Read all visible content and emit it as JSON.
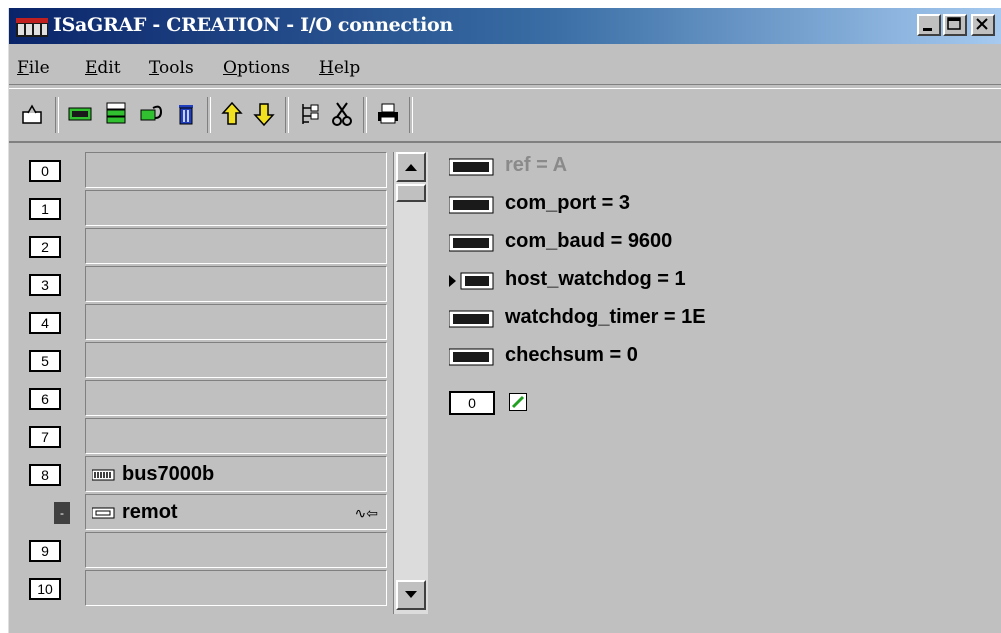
{
  "window": {
    "title": "ISaGRAF - CREATION - I/O connection",
    "controls": [
      "minimize",
      "maximize",
      "close"
    ]
  },
  "menu": [
    {
      "key": "F",
      "rest": "ile"
    },
    {
      "key": "E",
      "rest": "dit"
    },
    {
      "key": "T",
      "rest": "ools"
    },
    {
      "key": "O",
      "rest": "ptions"
    },
    {
      "key": "H",
      "rest": "elp"
    }
  ],
  "toolbar": [
    "open-icon",
    "board-icon",
    "stack-icon",
    "pin-icon",
    "trash-icon",
    "move-up-icon",
    "move-down-icon",
    "tree-icon",
    "cut-icon",
    "print-icon"
  ],
  "slots": [
    {
      "num": "0",
      "label": ""
    },
    {
      "num": "1",
      "label": ""
    },
    {
      "num": "2",
      "label": ""
    },
    {
      "num": "3",
      "label": ""
    },
    {
      "num": "4",
      "label": ""
    },
    {
      "num": "5",
      "label": ""
    },
    {
      "num": "6",
      "label": ""
    },
    {
      "num": "7",
      "label": ""
    },
    {
      "num": "8",
      "label": "bus7000b"
    },
    {
      "num": "-",
      "label": "remot",
      "link": "∿⇦"
    },
    {
      "num": "9",
      "label": ""
    },
    {
      "num": "10",
      "label": ""
    }
  ],
  "params": [
    {
      "text": "ref = A",
      "dim": true
    },
    {
      "text": "com_port = 3"
    },
    {
      "text": "com_baud = 9600"
    },
    {
      "text": "host_watchdog = 1",
      "arrow": true
    },
    {
      "text": "watchdog_timer = 1E"
    },
    {
      "text": "chechsum = 0"
    }
  ],
  "channel": {
    "num": "0"
  }
}
